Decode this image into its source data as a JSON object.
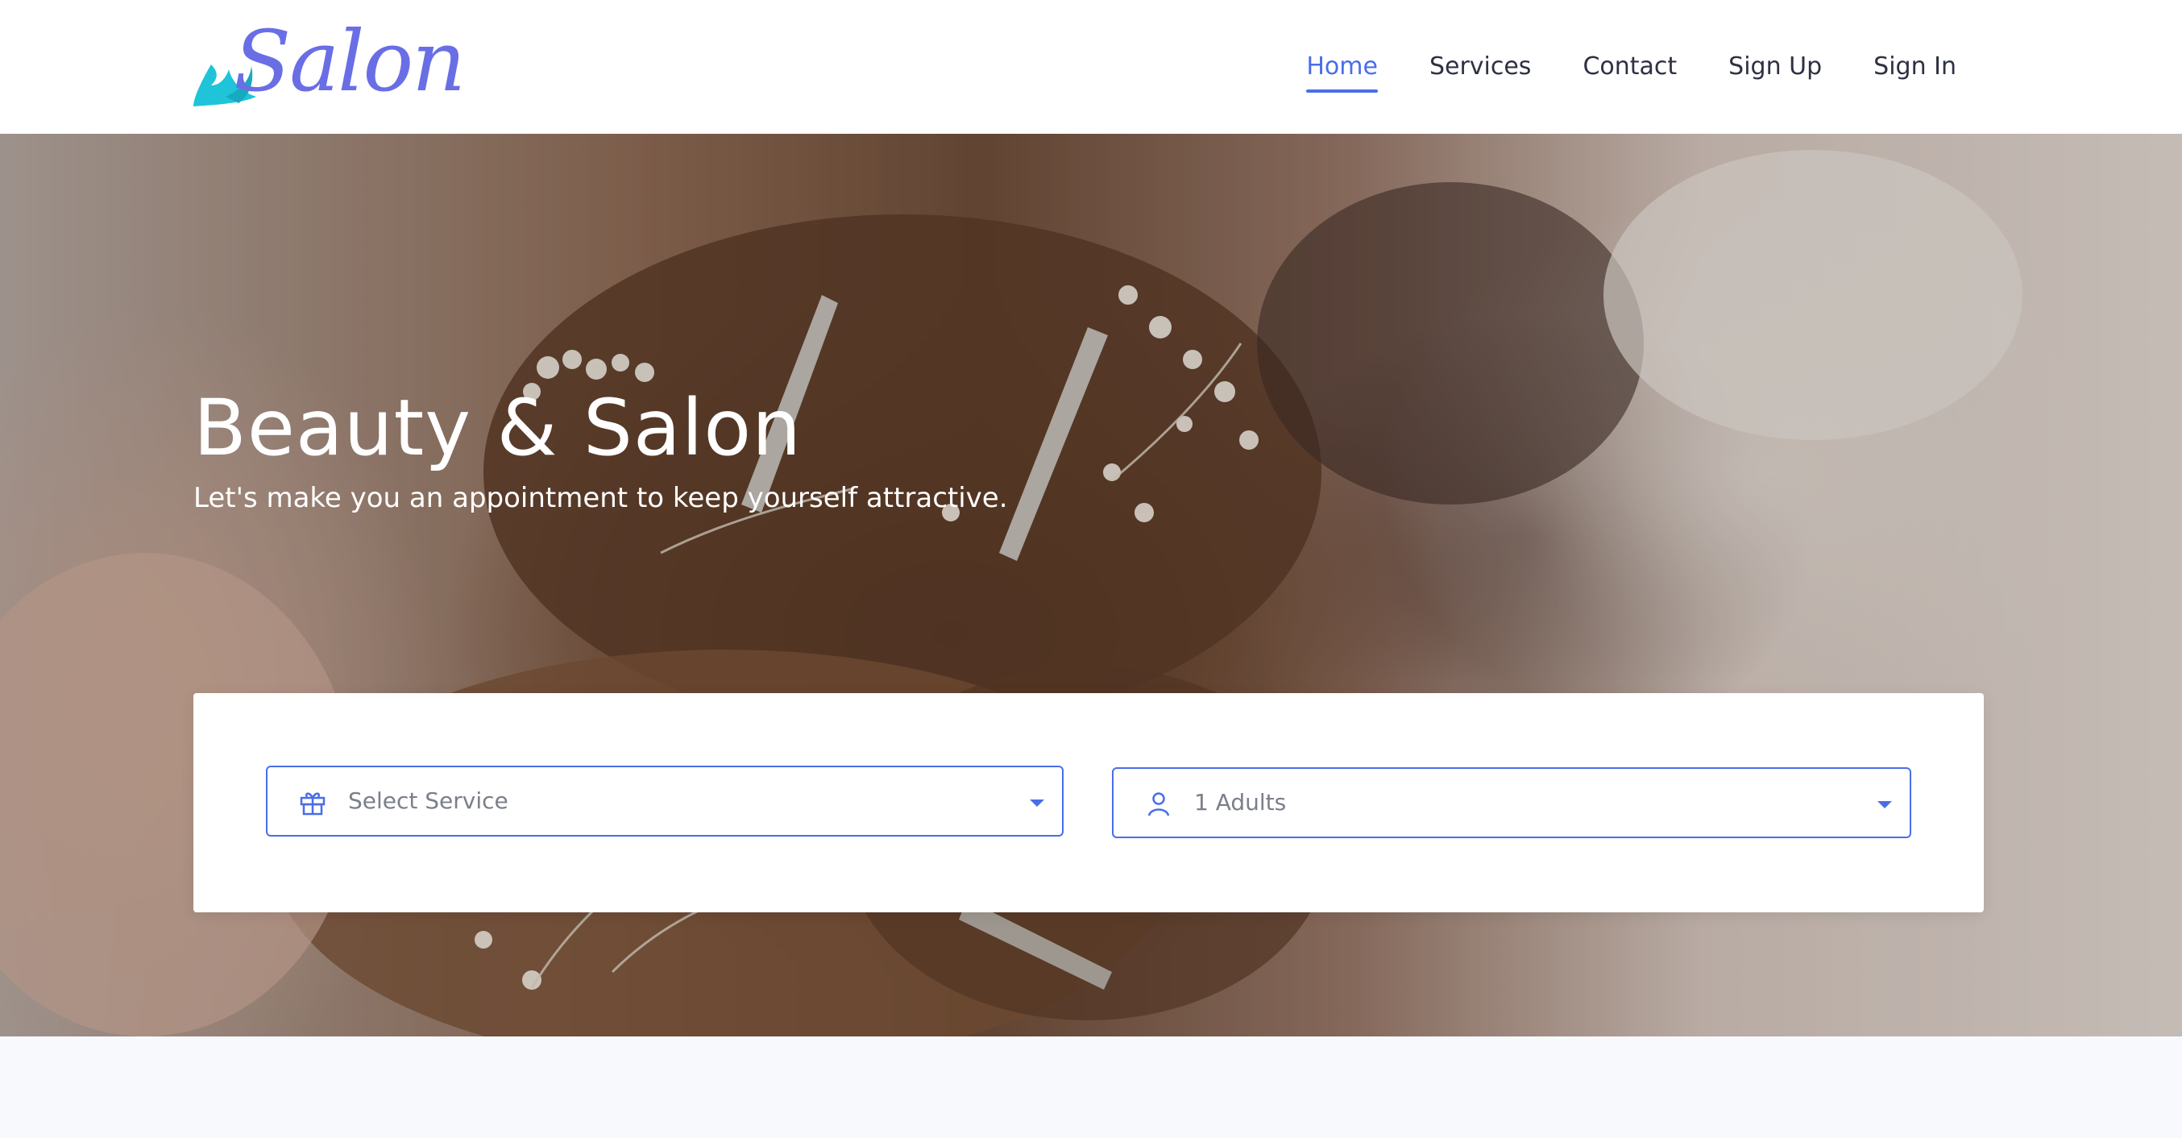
{
  "brand": {
    "logo_text": "Salon",
    "logo_color": "#6a6ee5",
    "logo_accent": "#1fc4d8"
  },
  "nav": {
    "items": [
      {
        "label": "Home",
        "active": true
      },
      {
        "label": "Services",
        "active": false
      },
      {
        "label": "Contact",
        "active": false
      },
      {
        "label": "Sign Up",
        "active": false
      },
      {
        "label": "Sign In",
        "active": false
      }
    ],
    "active_color": "#4a6ee8"
  },
  "hero": {
    "title": "Beauty & Salon",
    "subtitle": "Let's make you an appointment to keep yourself attractive."
  },
  "booking": {
    "service_select": {
      "value": "Select Service",
      "icon": "gift-icon"
    },
    "guests_select": {
      "value": "1 Adults",
      "icon": "user-icon"
    },
    "accent": "#4a6ee8"
  }
}
